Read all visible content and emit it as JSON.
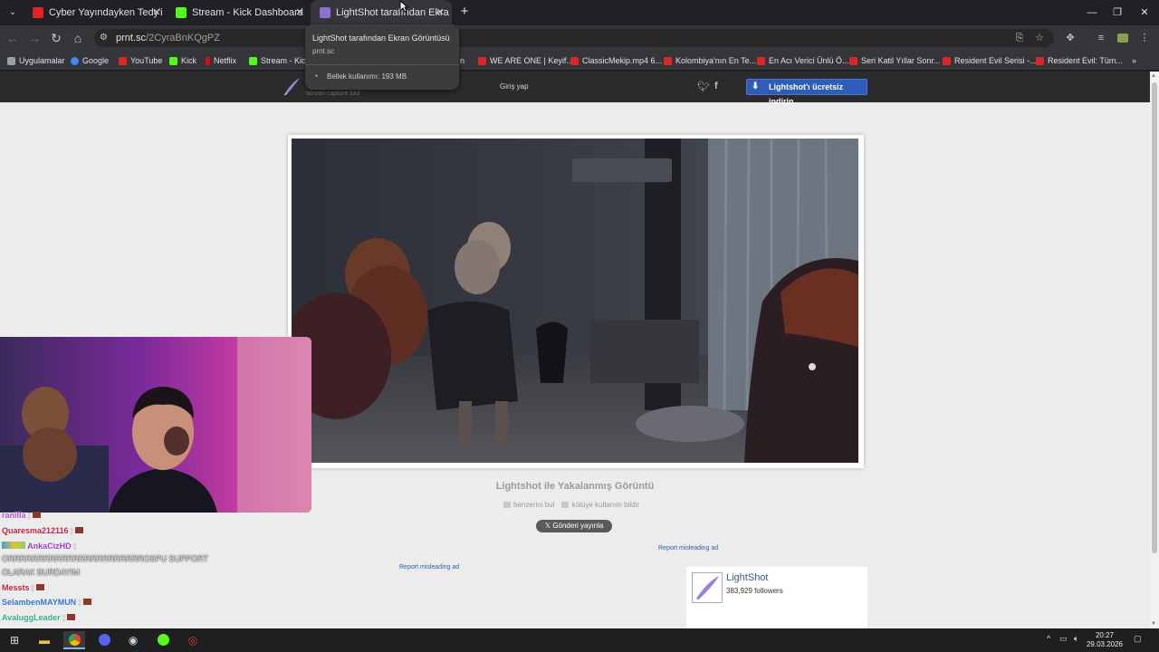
{
  "tabs": [
    {
      "title": "Cyber Yayındayken Tedy'in Tuvalet",
      "favicon_color": "#e02424"
    },
    {
      "title": "Stream - Kick Dashboard",
      "favicon_color": "#53fc18"
    },
    {
      "title": "LightShot tarafından Ekran Görüntüsü",
      "favicon_color": "#8e6fd0"
    }
  ],
  "address_bar": {
    "host": "prnt.sc",
    "path": "/2CyraBnKQgPZ"
  },
  "bookmarks": [
    {
      "label": "Uygulamalar",
      "color": "#9aa0a6"
    },
    {
      "label": "Google",
      "color": "#4285f4"
    },
    {
      "label": "YouTube",
      "color": "#e02424"
    },
    {
      "label": "Kick",
      "color": "#53fc18"
    },
    {
      "label": "Netflix",
      "color": "#e50914"
    },
    {
      "label": "Stream - Kick",
      "color": "#53fc18"
    },
    {
      "label": "n",
      "color": "#e02424"
    },
    {
      "label": "WE ARE ONE | Keyif...",
      "color": "#e02424"
    },
    {
      "label": "ClassicMekip.mp4 6...",
      "color": "#e02424"
    },
    {
      "label": "Kolombiya'nın En Te...",
      "color": "#e02424"
    },
    {
      "label": "En Acı Verici Ünlü Ö...",
      "color": "#e02424"
    },
    {
      "label": "Seri Katil Yıllar Sonr...",
      "color": "#e02424"
    },
    {
      "label": "Resident Evil Serisi -...",
      "color": "#e02424"
    },
    {
      "label": "Resident Evil: Tüm...",
      "color": "#e02424"
    }
  ],
  "tooltip": {
    "title": "LightShot tarafından Ekran Görüntüsü",
    "host": "prnt.sc",
    "memory": "Bellek kullanımı: 193 MB"
  },
  "site": {
    "tagline": "screen capture tool",
    "login": "Giriş yap",
    "download": "Lightshot'ı ücretsiz indirin",
    "caption": "Lightshot ile Yakalanmış Görüntü",
    "similar": "benzerini bul",
    "report_abuse": "kötüye kullanım bildir",
    "tweet": "Gönderi yayınla",
    "report_ad_1": "Report misleading ad",
    "report_ad_2": "Report misleading ad",
    "widget_name": "LightShot",
    "widget_followers": "383,929 followers"
  },
  "chat": [
    {
      "user": "ranilla",
      "msg": "",
      "color": "#b04bd0"
    },
    {
      "user": "Quaresma212116",
      "msg": "",
      "color": "#c0203a"
    },
    {
      "user": "AnkaCizHD",
      "msg": "",
      "color": "#9a3cc8"
    },
    {
      "user": "",
      "msg": "ORRRRRRRRRRRRRRRRRRRRRRROSPU SUPPORT",
      "color": "#f0f0f0"
    },
    {
      "user": "",
      "msg": "OLARAK BURDAYIM",
      "color": "#f0f0f0"
    },
    {
      "user": "Messts",
      "msg": "",
      "color": "#c0203a"
    },
    {
      "user": "SelambenMAYMUN",
      "msg": "",
      "color": "#2f6fd6"
    },
    {
      "user": "AvaluggLeader",
      "msg": "",
      "color": "#2fae7a"
    }
  ],
  "clock": {
    "time": "20:27",
    "date": "29.03.2026"
  }
}
